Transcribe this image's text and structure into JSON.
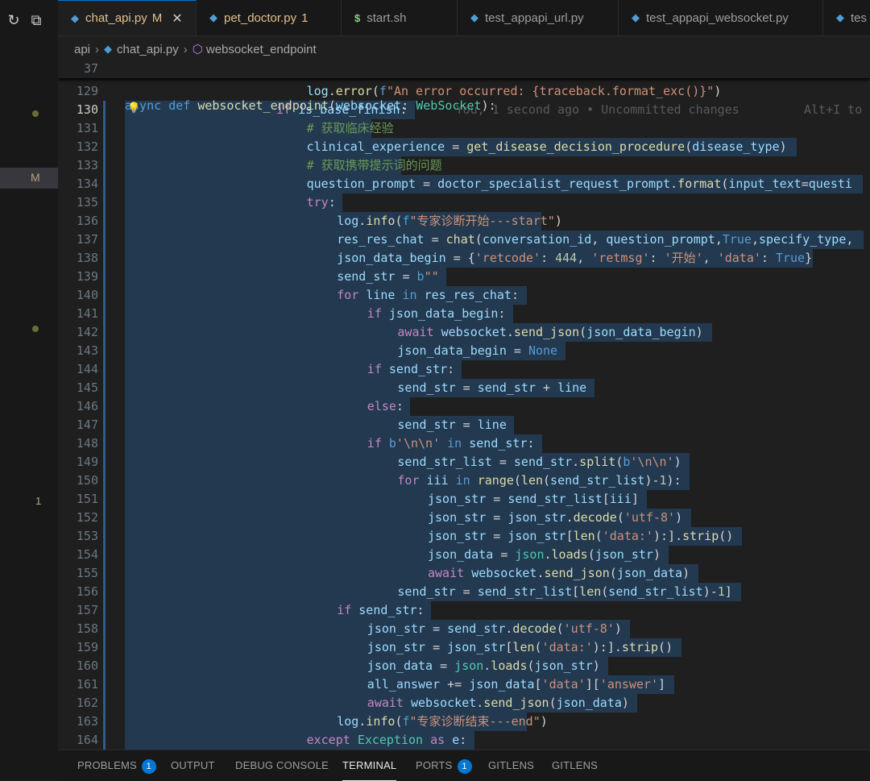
{
  "left_strip": {
    "refresh_icon": "↻",
    "collapse_icon": "⧉",
    "modified_marker": "M",
    "problem_count": "1"
  },
  "tabs": [
    {
      "name": "chat_api.py",
      "status": "M",
      "kind": "py",
      "active": true
    },
    {
      "name": "pet_doctor.py",
      "status": "1",
      "kind": "py",
      "active": false
    },
    {
      "name": "start.sh",
      "status": "",
      "kind": "sh",
      "active": false
    },
    {
      "name": "test_appapi_url.py",
      "status": "",
      "kind": "py",
      "active": false
    },
    {
      "name": "test_appapi_websocket.py",
      "status": "",
      "kind": "py",
      "active": false
    },
    {
      "name": "tes",
      "status": "",
      "kind": "py",
      "active": false
    }
  ],
  "breadcrumb": {
    "folder": "api",
    "file": "chat_api.py",
    "symbol": "websocket_endpoint"
  },
  "sticky": {
    "line_number": "37",
    "text": "async def websocket_endpoint(websocket: WebSocket):"
  },
  "blame": {
    "text": "You, 1 second ago • Uncommitted changes",
    "shortcut": "Alt+I to"
  },
  "code_lines": [
    {
      "n": "129",
      "indent": 6,
      "text": "log.error(f\"An error occurred: {traceback.format_exc()}\")"
    },
    {
      "n": "130",
      "indent": 5,
      "text": "if is_base_finish:"
    },
    {
      "n": "131",
      "indent": 6,
      "text": "# 获取临床经验"
    },
    {
      "n": "132",
      "indent": 6,
      "text": "clinical_experience = get_disease_decision_procedure(disease_type)"
    },
    {
      "n": "133",
      "indent": 6,
      "text": "# 获取携带提示词的问题"
    },
    {
      "n": "134",
      "indent": 6,
      "text": "question_prompt = doctor_specialist_request_prompt.format(input_text=questi"
    },
    {
      "n": "135",
      "indent": 6,
      "text": "try:"
    },
    {
      "n": "136",
      "indent": 7,
      "text": "log.info(f\"专家诊断开始---start\")"
    },
    {
      "n": "137",
      "indent": 7,
      "text": "res_res_chat = chat(conversation_id, question_prompt,True,specify_type,"
    },
    {
      "n": "138",
      "indent": 7,
      "text": "json_data_begin = {'retcode': 444, 'retmsg': '开始', 'data': True}"
    },
    {
      "n": "139",
      "indent": 7,
      "text": "send_str = b\"\""
    },
    {
      "n": "140",
      "indent": 7,
      "text": "for line in res_res_chat:"
    },
    {
      "n": "141",
      "indent": 8,
      "text": "if json_data_begin:"
    },
    {
      "n": "142",
      "indent": 9,
      "text": "await websocket.send_json(json_data_begin)"
    },
    {
      "n": "143",
      "indent": 9,
      "text": "json_data_begin = None"
    },
    {
      "n": "144",
      "indent": 8,
      "text": "if send_str:"
    },
    {
      "n": "145",
      "indent": 9,
      "text": "send_str = send_str + line"
    },
    {
      "n": "146",
      "indent": 8,
      "text": "else:"
    },
    {
      "n": "147",
      "indent": 9,
      "text": "send_str = line"
    },
    {
      "n": "148",
      "indent": 8,
      "text": "if b'\\n\\n' in send_str:"
    },
    {
      "n": "149",
      "indent": 9,
      "text": "send_str_list = send_str.split(b'\\n\\n')"
    },
    {
      "n": "150",
      "indent": 9,
      "text": "for iii in range(len(send_str_list)-1):"
    },
    {
      "n": "151",
      "indent": 10,
      "text": "json_str = send_str_list[iii]"
    },
    {
      "n": "152",
      "indent": 10,
      "text": "json_str = json_str.decode('utf-8')"
    },
    {
      "n": "153",
      "indent": 10,
      "text": "json_str = json_str[len('data:'):].strip()"
    },
    {
      "n": "154",
      "indent": 10,
      "text": "json_data = json.loads(json_str)"
    },
    {
      "n": "155",
      "indent": 10,
      "text": "await websocket.send_json(json_data)"
    },
    {
      "n": "156",
      "indent": 9,
      "text": "send_str = send_str_list[len(send_str_list)-1]"
    },
    {
      "n": "157",
      "indent": 7,
      "text": "if send_str:"
    },
    {
      "n": "158",
      "indent": 8,
      "text": "json_str = send_str.decode('utf-8')"
    },
    {
      "n": "159",
      "indent": 8,
      "text": "json_str = json_str[len('data:'):].strip()"
    },
    {
      "n": "160",
      "indent": 8,
      "text": "json_data = json.loads(json_str)"
    },
    {
      "n": "161",
      "indent": 8,
      "text": "all_answer += json_data['data']['answer']"
    },
    {
      "n": "162",
      "indent": 8,
      "text": "await websocket.send_json(json_data)"
    },
    {
      "n": "163",
      "indent": 7,
      "text": "log.info(f\"专家诊断结束---end\")"
    },
    {
      "n": "164",
      "indent": 6,
      "text": "except Exception as e:"
    }
  ],
  "current_line": "130",
  "panel_tabs": [
    {
      "label": "PROBLEMS",
      "badge": "1",
      "active": false
    },
    {
      "label": "OUTPUT",
      "badge": "",
      "active": false
    },
    {
      "label": "DEBUG CONSOLE",
      "badge": "",
      "active": false
    },
    {
      "label": "TERMINAL",
      "badge": "",
      "active": true
    },
    {
      "label": "PORTS",
      "badge": "1",
      "active": false
    },
    {
      "label": "GITLENS",
      "badge": "",
      "active": false
    },
    {
      "label": "GITLENS",
      "badge": "",
      "active": false
    }
  ],
  "colors": {
    "accent": "#0078d4",
    "modified": "#e2c08d",
    "selection": "#264f78"
  }
}
